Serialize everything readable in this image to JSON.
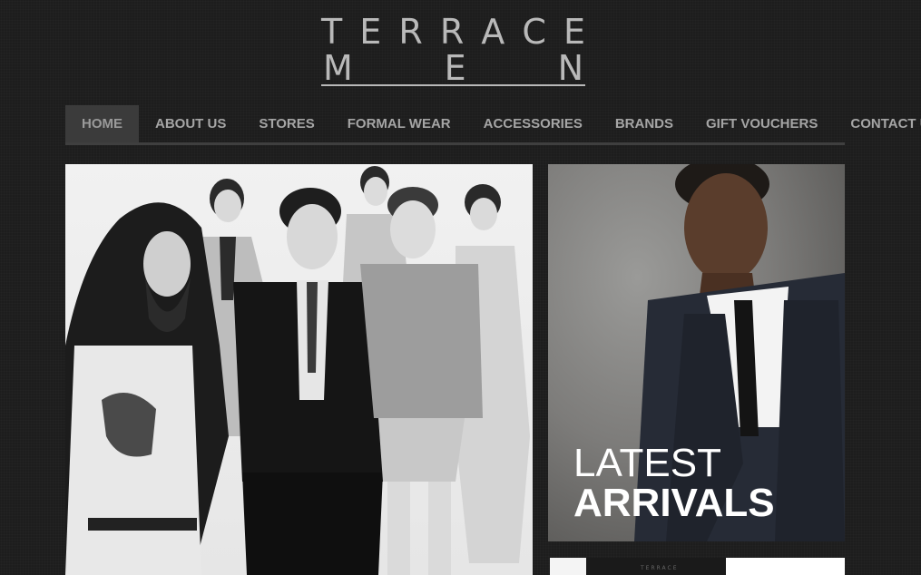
{
  "logo": {
    "line1": [
      "T",
      "E",
      "R",
      "R",
      "A",
      "C",
      "E"
    ],
    "line2": [
      "M",
      "E",
      "N"
    ]
  },
  "nav": {
    "items": [
      {
        "label": "HOME",
        "active": true
      },
      {
        "label": "ABOUT US",
        "active": false
      },
      {
        "label": "STORES",
        "active": false
      },
      {
        "label": "FORMAL WEAR",
        "active": false
      },
      {
        "label": "ACCESSORIES",
        "active": false
      },
      {
        "label": "BRANDS",
        "active": false
      },
      {
        "label": "GIFT VOUCHERS",
        "active": false
      },
      {
        "label": "CONTACT US",
        "active": false
      }
    ]
  },
  "promo": {
    "line1": "LATEST",
    "line2": "ARRIVALS"
  },
  "strip": {
    "tiny_text": "TERRACE"
  },
  "colors": {
    "background": "#1d1d1d",
    "nav_text": "#a5a5a5",
    "nav_active_bg": "#3b3b3b",
    "logo": "#b9b9b9"
  }
}
